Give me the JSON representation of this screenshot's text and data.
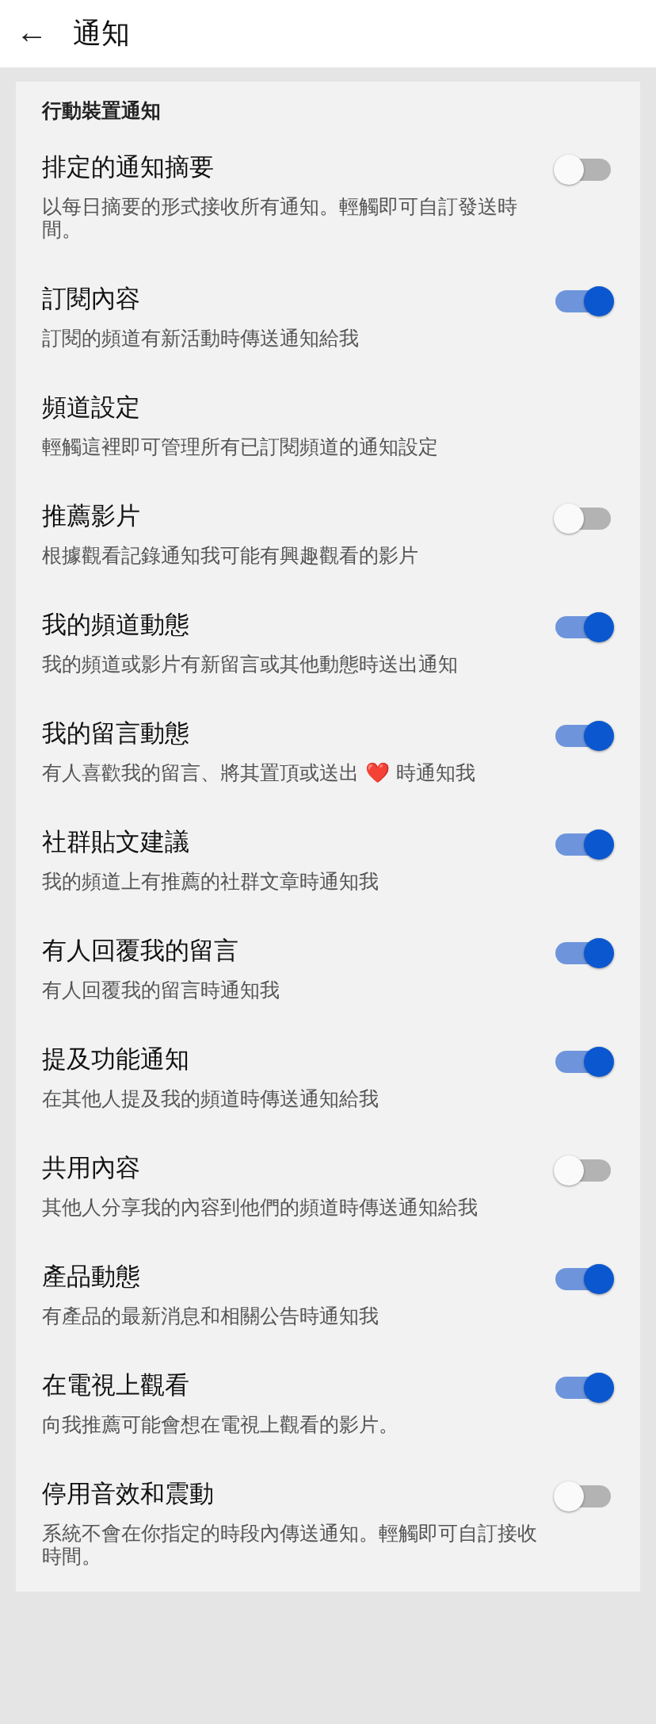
{
  "header": {
    "back_icon": "←",
    "title": "通知"
  },
  "section": {
    "title": "行動裝置通知"
  },
  "settings": [
    {
      "kind": "toggle",
      "title": "排定的通知摘要",
      "description": "以每日摘要的形式接收所有通知。輕觸即可自訂發送時間。",
      "on": false
    },
    {
      "kind": "toggle",
      "title": "訂閱內容",
      "description": "訂閱的頻道有新活動時傳送通知給我",
      "on": true
    },
    {
      "kind": "link",
      "title": "頻道設定",
      "description": "輕觸這裡即可管理所有已訂閱頻道的通知設定"
    },
    {
      "kind": "toggle",
      "title": "推薦影片",
      "description": "根據觀看記錄通知我可能有興趣觀看的影片",
      "on": false
    },
    {
      "kind": "toggle",
      "title": "我的頻道動態",
      "description": "我的頻道或影片有新留言或其他動態時送出通知",
      "on": true
    },
    {
      "kind": "toggle",
      "title": "我的留言動態",
      "description": "有人喜歡我的留言、將其置頂或送出 ❤️ 時通知我",
      "on": true
    },
    {
      "kind": "toggle",
      "title": "社群貼文建議",
      "description": "我的頻道上有推薦的社群文章時通知我",
      "on": true
    },
    {
      "kind": "toggle",
      "title": "有人回覆我的留言",
      "description": "有人回覆我的留言時通知我",
      "on": true
    },
    {
      "kind": "toggle",
      "title": "提及功能通知",
      "description": "在其他人提及我的頻道時傳送通知給我",
      "on": true
    },
    {
      "kind": "toggle",
      "title": "共用內容",
      "description": "其他人分享我的內容到他們的頻道時傳送通知給我",
      "on": false
    },
    {
      "kind": "toggle",
      "title": "產品動態",
      "description": "有產品的最新消息和相關公告時通知我",
      "on": true
    },
    {
      "kind": "toggle",
      "title": "在電視上觀看",
      "description": "向我推薦可能會想在電視上觀看的影片。",
      "on": true
    },
    {
      "kind": "toggle",
      "title": "停用音效和震動",
      "description": "系統不會在你指定的時段內傳送通知。輕觸即可自訂接收時間。",
      "on": false
    }
  ]
}
